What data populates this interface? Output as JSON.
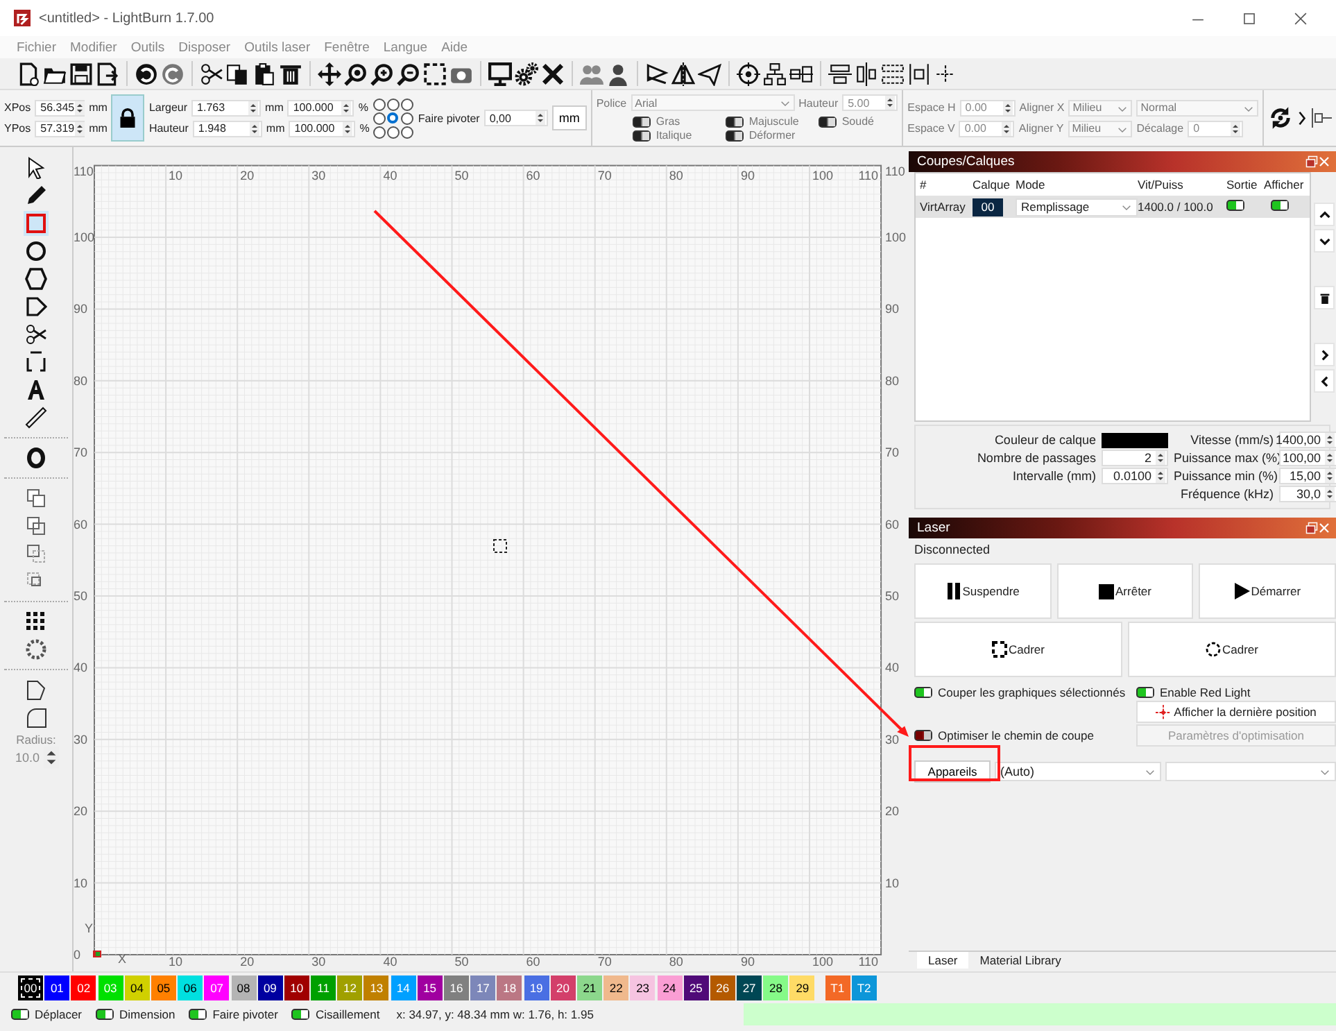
{
  "window": {
    "title": "<untitled> - LightBurn 1.7.00"
  },
  "menu": [
    "Fichier",
    "Modifier",
    "Outils",
    "Disposer",
    "Outils laser",
    "Fenêtre",
    "Langue",
    "Aide"
  ],
  "properties": {
    "xpos": {
      "label": "XPos",
      "value": "56.345",
      "unit": "mm"
    },
    "ypos": {
      "label": "YPos",
      "value": "57.319",
      "unit": "mm"
    },
    "lock_on": true,
    "width": {
      "label": "Largeur",
      "value": "1.763",
      "unit": "mm",
      "percent": "100.000",
      "percent_unit": "%"
    },
    "height": {
      "label": "Hauteur",
      "value": "1.948",
      "unit": "mm",
      "percent": "100.000",
      "percent_unit": "%"
    },
    "anchors": [
      {
        "selected": false
      },
      {
        "selected": false
      },
      {
        "selected": false
      },
      {
        "selected": false
      },
      {
        "selected": true
      },
      {
        "selected": false
      },
      {
        "selected": false
      },
      {
        "selected": false
      },
      {
        "selected": false
      }
    ],
    "rotate": {
      "label": "Faire pivoter",
      "value": "0,00"
    },
    "unit_button": "mm"
  },
  "text_options": {
    "font": {
      "label": "Police",
      "value": "Arial"
    },
    "height": {
      "label": "Hauteur",
      "value": "5.00"
    },
    "toggles": [
      {
        "label": "Gras",
        "on": false
      },
      {
        "label": "Majuscule",
        "on": false
      },
      {
        "label": "Soudé",
        "on": false
      },
      {
        "label": "Italique",
        "on": false
      },
      {
        "label": "Déformer",
        "on": false
      }
    ],
    "spacing_h": {
      "label": "Espace H",
      "value": "0.00"
    },
    "spacing_v": {
      "label": "Espace V",
      "value": "0.00"
    },
    "align_x": {
      "label": "Aligner X",
      "value": "Milieu"
    },
    "align_y": {
      "label": "Aligner Y",
      "value": "Milieu"
    },
    "style": "Normal",
    "offset": {
      "label": "Décalage",
      "value": "0"
    }
  },
  "tools": [
    {
      "selected": false
    },
    {
      "selected": false
    },
    {
      "selected": true
    },
    {
      "selected": false
    },
    {
      "selected": false
    },
    {
      "selected": false
    },
    {
      "selected": false
    },
    {
      "selected": false
    },
    {
      "selected": false
    },
    {
      "selected": false
    }
  ],
  "radius": {
    "label": "Radius:",
    "value": "10.0"
  },
  "canvas": {
    "top_ruler": [
      "10",
      "20",
      "30",
      "40",
      "50",
      "60",
      "70",
      "80",
      "90",
      "100",
      "110"
    ],
    "left_ruler": [
      "110",
      "100",
      "90",
      "80",
      "70",
      "60",
      "50",
      "40",
      "30",
      "20",
      "10",
      "0"
    ],
    "right_ruler": [
      "110",
      "100",
      "90",
      "80",
      "70",
      "60",
      "50",
      "40",
      "30",
      "20",
      "10"
    ],
    "bottom_ruler": [
      "10",
      "20",
      "30",
      "40",
      "50",
      "60",
      "70",
      "80",
      "90",
      "100",
      "110"
    ],
    "x_axis": "X",
    "y_axis": "Y"
  },
  "cuts_panel": {
    "title": "Coupes/Calques",
    "columns": [
      "#",
      "Calque",
      "Mode",
      "Vit/Puiss",
      "Sortie",
      "Afficher"
    ],
    "rows": [
      {
        "name": "VirtArray",
        "layer": "00",
        "mode": "Remplissage",
        "speed_power": "1400.0 / 100.0",
        "output": true,
        "show": true,
        "selected": true
      }
    ],
    "layer_color": {
      "label": "Couleur de calque",
      "color": "#000000"
    },
    "passes": {
      "label": "Nombre de passages",
      "value": "2"
    },
    "interval": {
      "label": "Intervalle (mm)",
      "value": "0.0100"
    },
    "speed": {
      "label": "Vitesse (mm/s)",
      "value": "1400,00"
    },
    "max_power": {
      "label": "Puissance max (%)",
      "value": "100,00"
    },
    "min_power": {
      "label": "Puissance min (%)",
      "value": "15,00"
    },
    "frequency": {
      "label": "Fréquence (kHz)",
      "value": "30,0"
    }
  },
  "laser_panel": {
    "title": "Laser",
    "status": "Disconnected",
    "buttons": [
      {
        "kind": "pause",
        "label": "Suspendre"
      },
      {
        "kind": "stop",
        "label": "Arrêter"
      },
      {
        "kind": "start",
        "label": "Démarrer"
      }
    ],
    "frame_buttons": [
      {
        "kind": "rect",
        "label": "Cadrer"
      },
      {
        "kind": "circle",
        "label": "Cadrer"
      }
    ],
    "cut_selected": {
      "label": "Couper les graphiques sélectionnés",
      "on": true
    },
    "red_light": {
      "label": "Enable Red Light",
      "on": true
    },
    "last_position": "Afficher la dernière position",
    "optimize": {
      "label": "Optimiser le chemin de coupe",
      "on": false
    },
    "optimization_settings": {
      "label": "Paramètres d'optimisation",
      "disabled": true
    },
    "devices_button": "Appareils",
    "port": "(Auto)",
    "tabs": [
      {
        "label": "Laser",
        "selected": true
      },
      {
        "label": "Material Library",
        "selected": false
      }
    ]
  },
  "palette": [
    {
      "label": "00",
      "color": "#000000",
      "selected": true
    },
    {
      "label": "01",
      "color": "#0000ff",
      "selected": false
    },
    {
      "label": "02",
      "color": "#ff0000",
      "selected": false
    },
    {
      "label": "03",
      "color": "#00e000",
      "selected": false
    },
    {
      "label": "04",
      "color": "#d0d000",
      "selected": false
    },
    {
      "label": "05",
      "color": "#ff8000",
      "selected": false
    },
    {
      "label": "06",
      "color": "#00e0e0",
      "selected": false
    },
    {
      "label": "07",
      "color": "#ff00ff",
      "selected": false
    },
    {
      "label": "08",
      "color": "#b4b4b4",
      "selected": false
    },
    {
      "label": "09",
      "color": "#0000a0",
      "selected": false
    },
    {
      "label": "10",
      "color": "#a00000",
      "selected": false
    },
    {
      "label": "11",
      "color": "#00a000",
      "selected": false
    },
    {
      "label": "12",
      "color": "#a0a000",
      "selected": false
    },
    {
      "label": "13",
      "color": "#c08000",
      "selected": false
    },
    {
      "label": "14",
      "color": "#00a0ff",
      "selected": false
    },
    {
      "label": "15",
      "color": "#a000a0",
      "selected": false
    },
    {
      "label": "16",
      "color": "#808080",
      "selected": false
    },
    {
      "label": "17",
      "color": "#7d87b9",
      "selected": false
    },
    {
      "label": "18",
      "color": "#bb7784",
      "selected": false
    },
    {
      "label": "19",
      "color": "#4a6fe3",
      "selected": false
    },
    {
      "label": "20",
      "color": "#d33f6a",
      "selected": false
    },
    {
      "label": "21",
      "color": "#8cd78c",
      "selected": false
    },
    {
      "label": "22",
      "color": "#f0b98d",
      "selected": false
    },
    {
      "label": "23",
      "color": "#f6c4e1",
      "selected": false
    },
    {
      "label": "24",
      "color": "#fa9ed4",
      "selected": false
    },
    {
      "label": "25",
      "color": "#500a78",
      "selected": false
    },
    {
      "label": "26",
      "color": "#b45a00",
      "selected": false
    },
    {
      "label": "27",
      "color": "#004754",
      "selected": false
    },
    {
      "label": "28",
      "color": "#86fa88",
      "selected": false
    },
    {
      "label": "29",
      "color": "#ffdb66",
      "selected": false
    },
    {
      "label": "T1",
      "color": "#f36926",
      "selected": false
    },
    {
      "label": "T2",
      "color": "#0c96d9",
      "selected": false
    }
  ],
  "status_bar": {
    "toggles": [
      {
        "label": "Déplacer",
        "on": true
      },
      {
        "label": "Dimension",
        "on": true
      },
      {
        "label": "Faire pivoter",
        "on": true
      },
      {
        "label": "Cisaillement",
        "on": true
      }
    ],
    "coords": "x: 34.97, y: 48.34 mm  w: 1.76,  h: 1.95"
  }
}
